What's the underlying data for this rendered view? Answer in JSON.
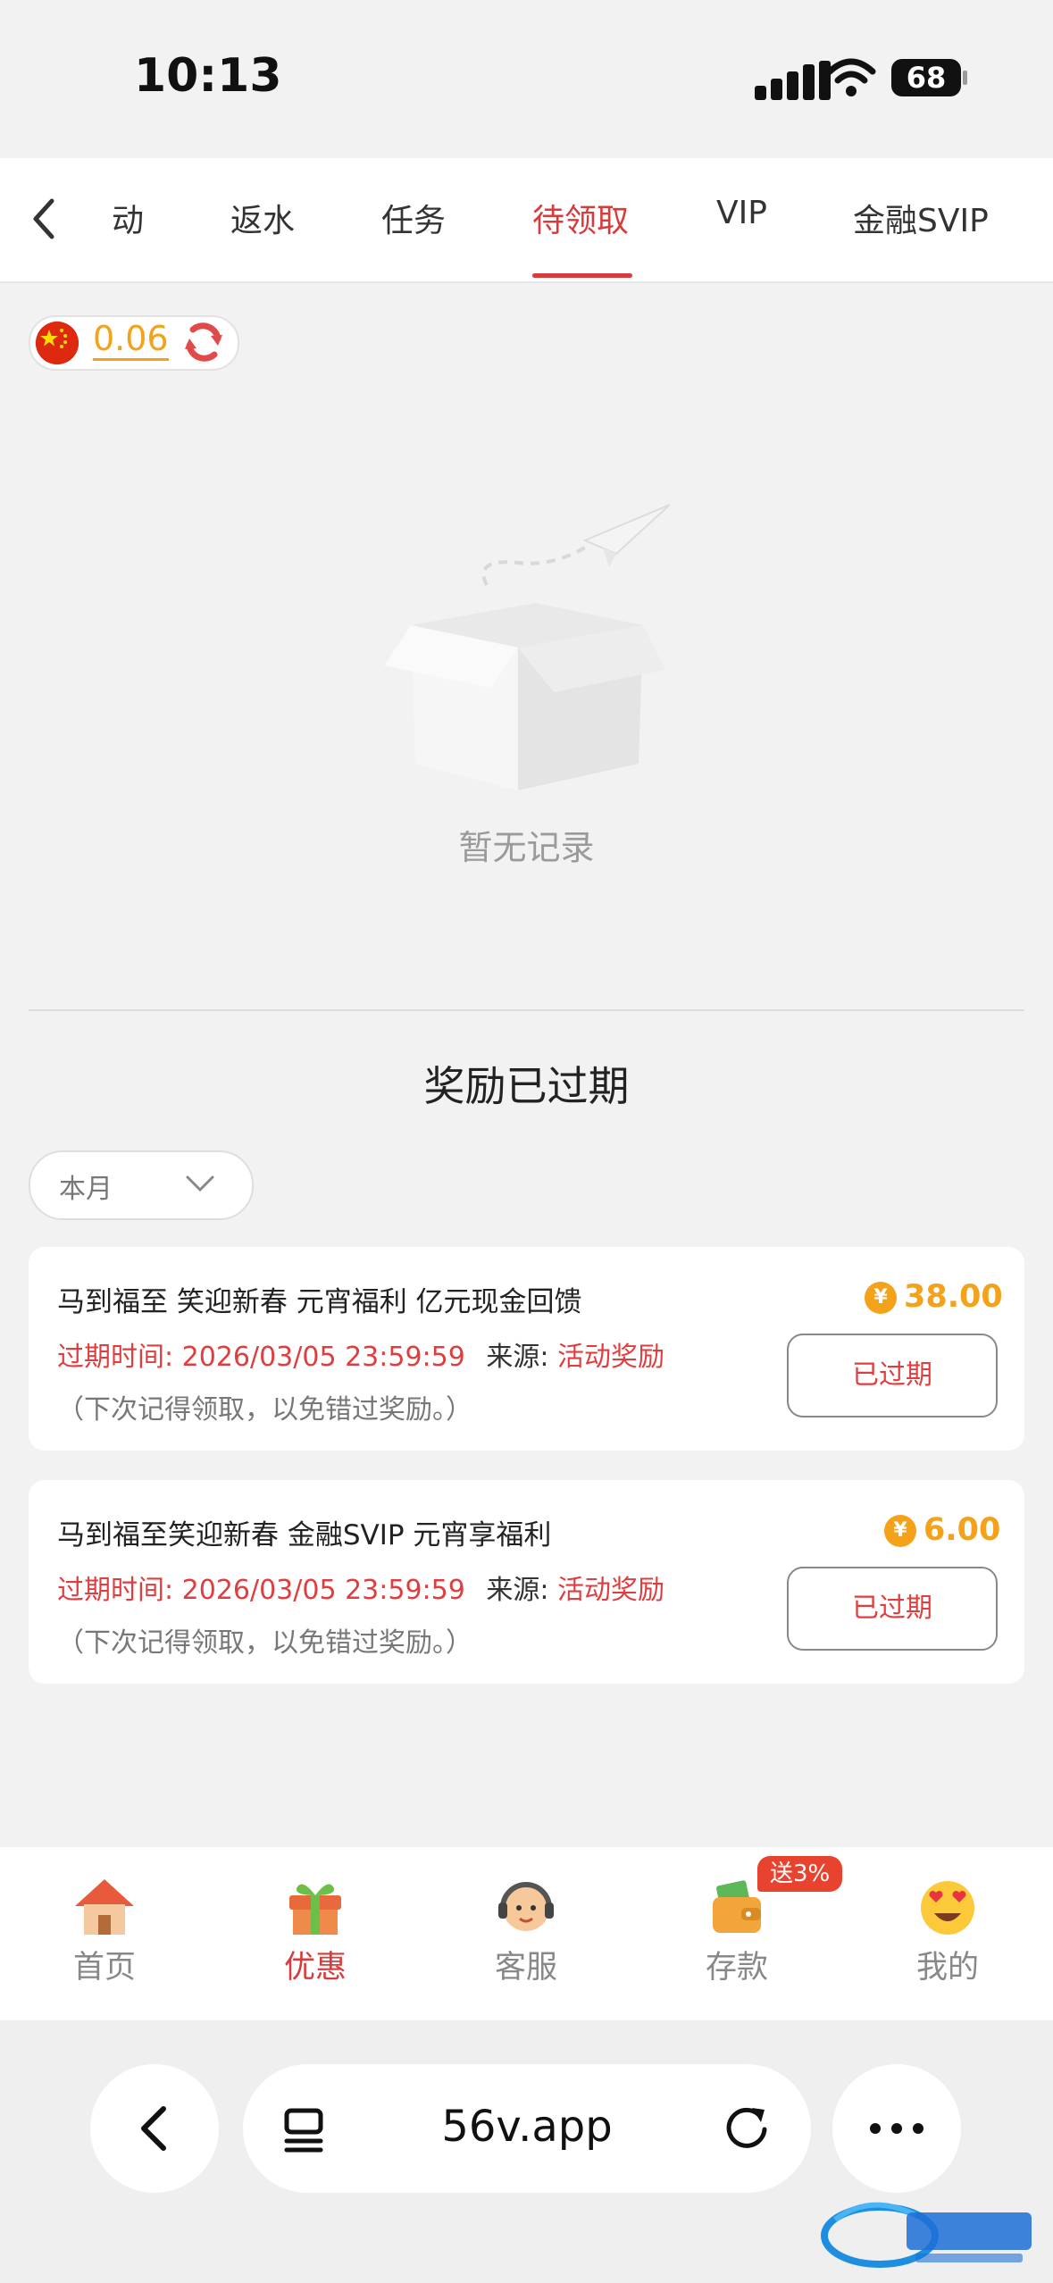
{
  "status_bar": {
    "time": "10:13",
    "battery": "68"
  },
  "tabs": [
    {
      "label": "动"
    },
    {
      "label": "返水"
    },
    {
      "label": "任务"
    },
    {
      "label": "待领取"
    },
    {
      "label": "VIP"
    },
    {
      "label": "金融SVIP"
    }
  ],
  "active_tab": "待领取",
  "balance": {
    "value": "0.06"
  },
  "empty_state": {
    "text": "暂无记录"
  },
  "expired_section": {
    "title": "奖励已过期",
    "filter_value": "本月",
    "items": [
      {
        "title": "马到福至 笑迎新春 元宵福利 亿元现金回馈",
        "expire_label": "过期时间: 2026/03/05 23:59:59",
        "source_label": "来源:",
        "source_value": "活动奖励",
        "note": "（下次记得领取，以免错过奖励。）",
        "amount": "38.00",
        "button": "已过期"
      },
      {
        "title": "马到福至笑迎新春 金融SVIP 元宵享福利",
        "expire_label": "过期时间: 2026/03/05 23:59:59",
        "source_label": "来源:",
        "source_value": "活动奖励",
        "note": "（下次记得领取，以免错过奖励。）",
        "amount": "6.00",
        "button": "已过期"
      }
    ]
  },
  "bottom_nav": [
    {
      "label": "首页",
      "icon": "house-icon"
    },
    {
      "label": "优惠",
      "icon": "gift-icon"
    },
    {
      "label": "客服",
      "icon": "headset-agent-icon"
    },
    {
      "label": "存款",
      "icon": "wallet-icon"
    },
    {
      "label": "我的",
      "icon": "heart-eyes-face-icon"
    }
  ],
  "promo_badge": "送3%",
  "currency_symbol": "¥",
  "browser": {
    "url": "56v.app"
  },
  "colors": {
    "accent": "#d93a3a",
    "gold": "#f3a21a",
    "expire_red": "#e03e3e"
  }
}
